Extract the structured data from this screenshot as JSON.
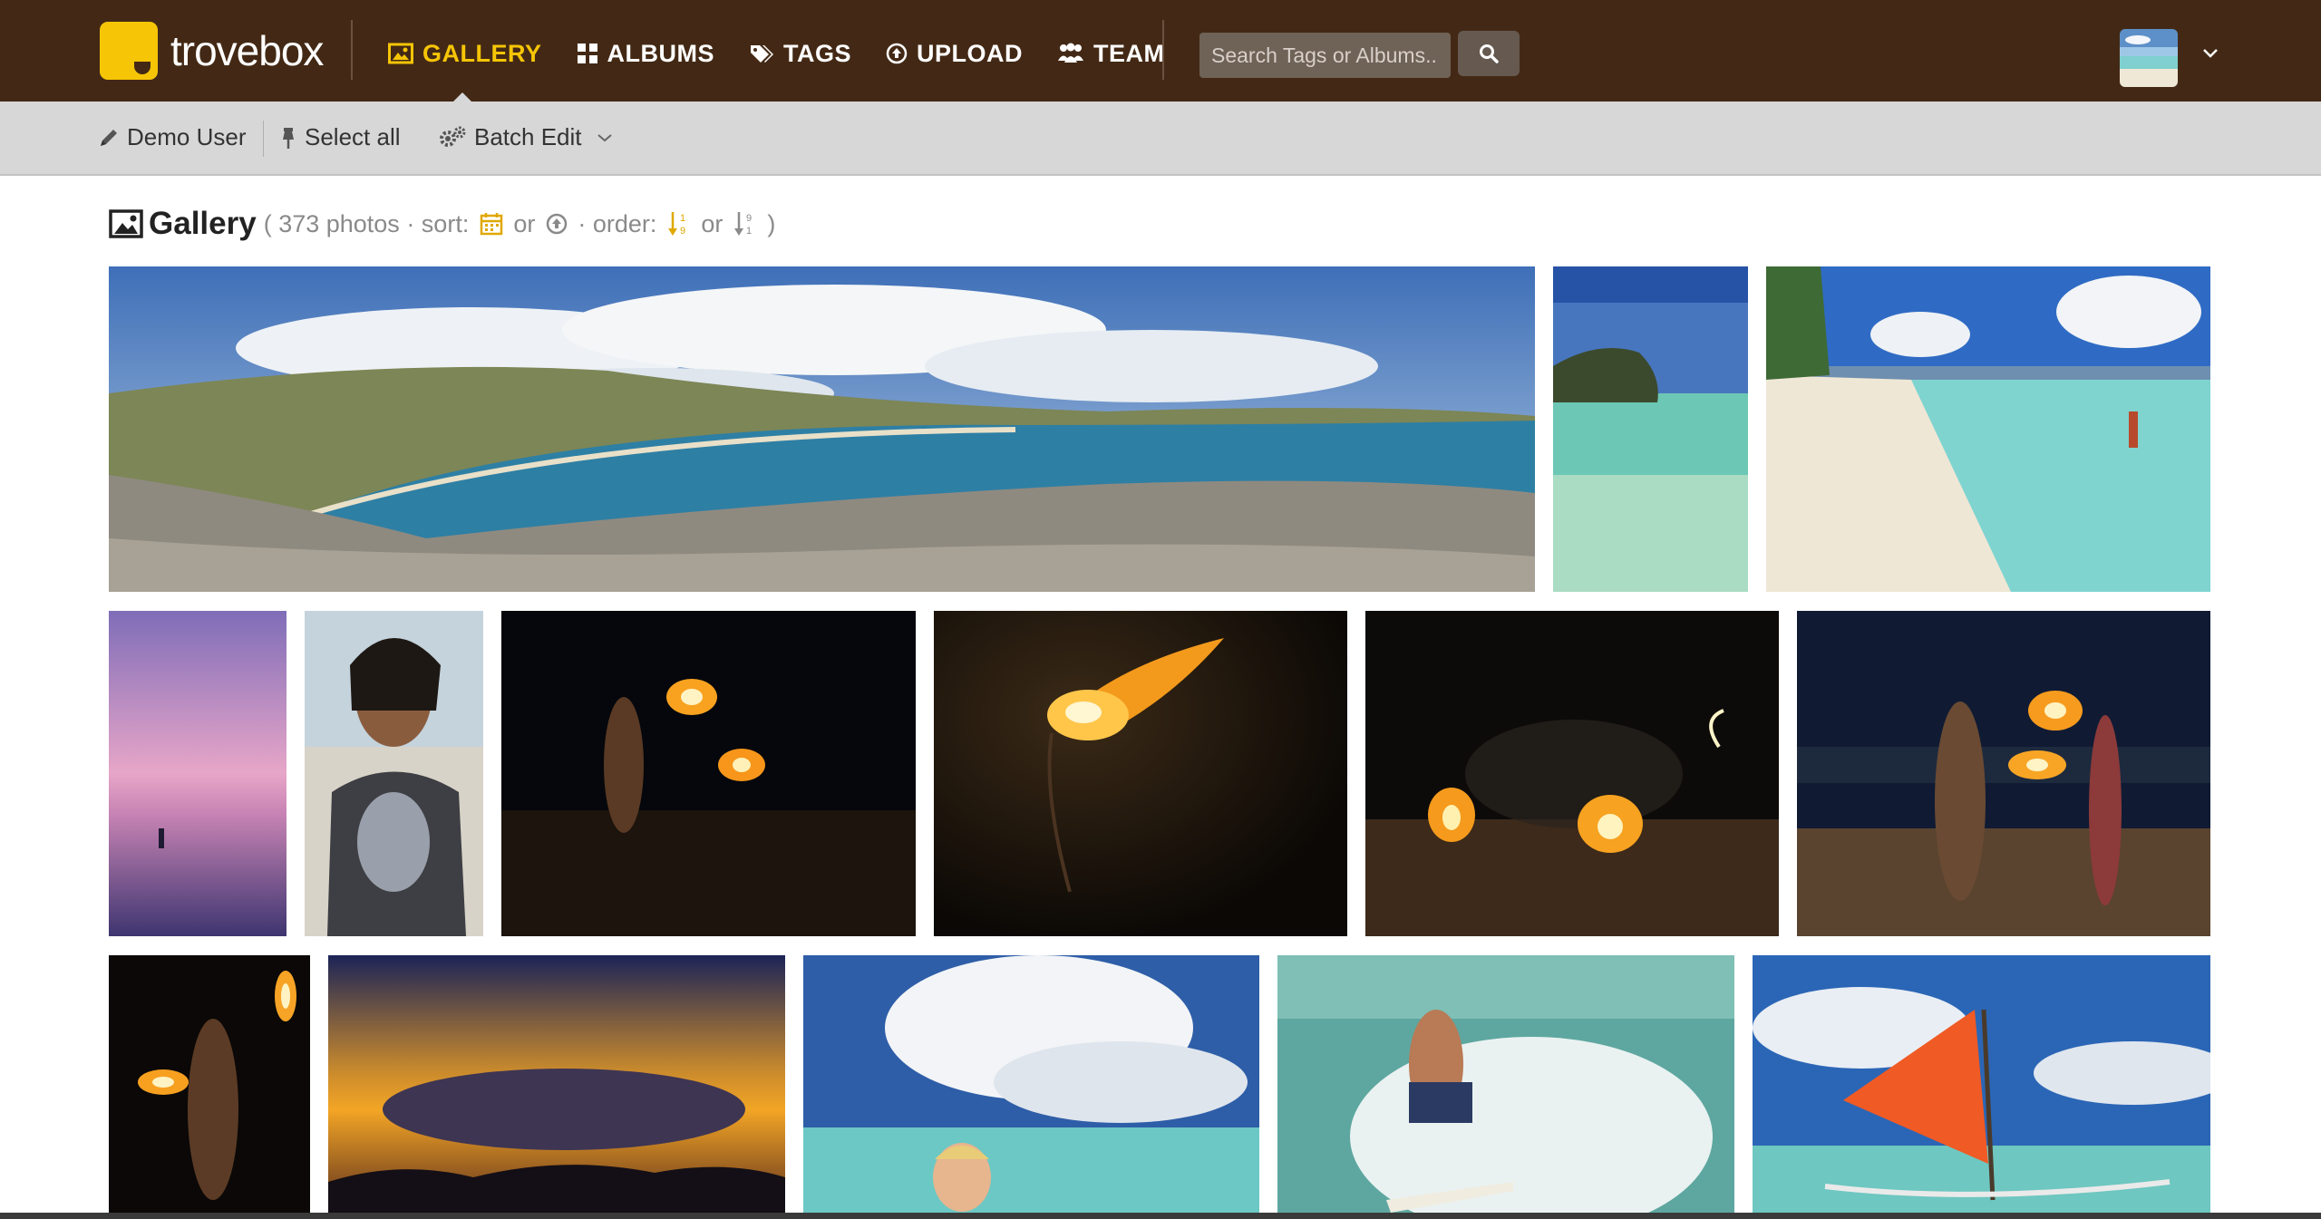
{
  "app": {
    "logo_text": "trovebox"
  },
  "nav": {
    "items": [
      {
        "label": "GALLERY",
        "icon": "picture-icon",
        "active": true
      },
      {
        "label": "ALBUMS",
        "icon": "grid-icon",
        "active": false
      },
      {
        "label": "TAGS",
        "icon": "tags-icon",
        "active": false
      },
      {
        "label": "UPLOAD",
        "icon": "upload-icon",
        "active": false
      },
      {
        "label": "TEAM",
        "icon": "team-icon",
        "active": false
      }
    ],
    "search_placeholder": "Search Tags or Albums...",
    "colors": {
      "bar": "#432915",
      "accent": "#f6c506"
    }
  },
  "toolbar": {
    "user_label": "Demo User",
    "select_all_label": "Select all",
    "batch_edit_label": "Batch Edit"
  },
  "gallery": {
    "title": "Gallery",
    "count_text": "( 373 photos · sort: ",
    "or_1": " or ",
    "order_text": " · order: ",
    "or_2": " or ",
    "close_paren": " )"
  },
  "photos": [
    {
      "subject": "coastal bay panorama"
    },
    {
      "subject": "clear water and rock"
    },
    {
      "subject": "white sand beach"
    },
    {
      "subject": "pink sunset sea"
    },
    {
      "subject": "smiling man portrait"
    },
    {
      "subject": "fire dancer"
    },
    {
      "subject": "flaming torch"
    },
    {
      "subject": "beach fire show"
    },
    {
      "subject": "fire dancers at night"
    },
    {
      "subject": "fire spinner"
    },
    {
      "subject": "orange sunset clouds"
    },
    {
      "subject": "swimmer under clouds"
    },
    {
      "subject": "surfer splash"
    },
    {
      "subject": "orange sail boat"
    }
  ]
}
